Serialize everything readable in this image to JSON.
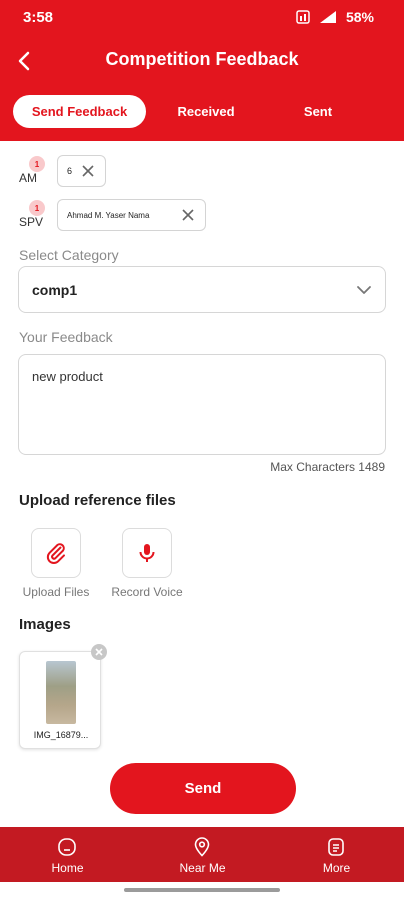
{
  "status_bar": {
    "time": "3:58",
    "battery": "58%"
  },
  "header": {
    "title": "Competition Feedback"
  },
  "tabs": [
    {
      "label": "Send Feedback"
    },
    {
      "label": "Received"
    },
    {
      "label": "Sent"
    }
  ],
  "am": {
    "label": "AM",
    "count": "1",
    "value": "6"
  },
  "spv": {
    "label": "SPV",
    "count": "1",
    "value": "Ahmad M. Yaser Nama"
  },
  "category": {
    "label": "Select Category",
    "value": "comp1"
  },
  "feedback": {
    "label": "Your Feedback",
    "value": "new product",
    "max_chars": "Max Characters 1489"
  },
  "upload": {
    "heading": "Upload reference files",
    "files_label": "Upload Files",
    "voice_label": "Record Voice"
  },
  "images": {
    "heading": "Images",
    "items": [
      {
        "name": "IMG_16879..."
      }
    ]
  },
  "send_button": "Send",
  "bottom_nav": [
    {
      "label": "Home",
      "icon": "home-icon"
    },
    {
      "label": "Near Me",
      "icon": "location-pin-icon"
    },
    {
      "label": "More",
      "icon": "document-icon"
    }
  ],
  "colors": {
    "primary": "#e3151e",
    "nav_bg": "#c31a22",
    "badge_bg": "#f9c9cb"
  }
}
